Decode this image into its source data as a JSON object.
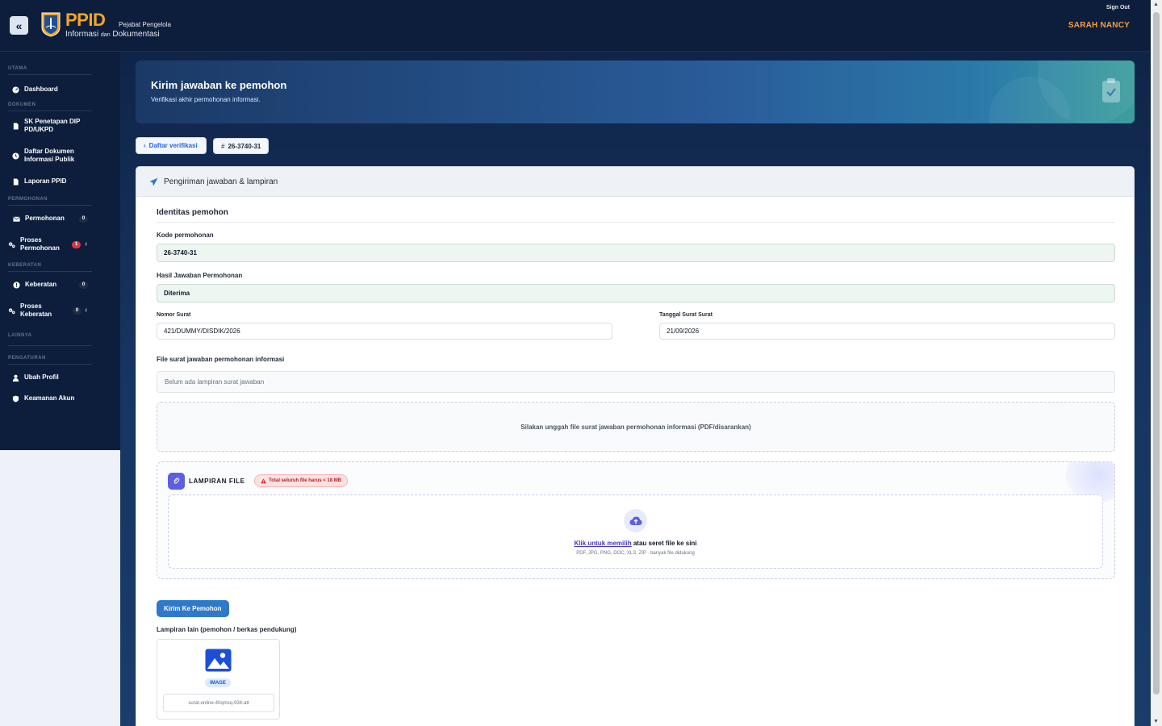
{
  "header": {
    "logo_text": "PPID",
    "logo_sub_top": "Pejabat Pengelola",
    "logo_sub_info": "Informasi",
    "logo_sub_dan": "dan",
    "logo_sub_dok": "Dokumentasi",
    "sign_out": "Sign Out",
    "user_name": "SARAH NANCY",
    "accent_color": "#f5a524"
  },
  "sidebar": {
    "sections": [
      {
        "title": "UTAMA",
        "items": [
          {
            "label": "Dashboard",
            "icon": "dashboard-icon"
          }
        ]
      },
      {
        "title": "DOKUMEN",
        "items": [
          {
            "label": "SK Penetapan DIP PD/UKPD",
            "icon": "file-icon"
          },
          {
            "label": "Daftar Dokumen Informasi Publik",
            "icon": "clock-icon"
          },
          {
            "label": "Laporan PPID",
            "icon": "file-icon"
          }
        ]
      },
      {
        "title": "PERMOHONAN",
        "items": [
          {
            "label": "Permohonan",
            "icon": "envelope-icon",
            "badge": "0"
          },
          {
            "label": "Proses Permohonan",
            "icon": "cogs-icon",
            "badge": "1"
          }
        ]
      },
      {
        "title": "KEBERATAN",
        "items": [
          {
            "label": "Keberatan",
            "icon": "alert-icon",
            "badge": "0"
          },
          {
            "label": "Proses Keberatan",
            "icon": "cogs-icon",
            "badge": "0"
          }
        ]
      },
      {
        "title": "LAINNYA",
        "items": []
      },
      {
        "title": "PENGATURAN",
        "items": [
          {
            "label": "Ubah Profil",
            "icon": "user-icon"
          },
          {
            "label": "Keamanan Akun",
            "icon": "shield-icon"
          }
        ]
      }
    ]
  },
  "hero": {
    "title": "Kirim jawaban ke pemohon",
    "subtitle": "Verifikasi akhir permohonan informasi."
  },
  "breadcrumb": {
    "back_label": "Daftar verifikasi",
    "code_label": "26-3740-31"
  },
  "card": {
    "header": "Pengiriman jawaban & lampiran",
    "section_title": "Identitas pemohon",
    "kode_label": "Kode permohonan",
    "kode_value": "26-3740-31",
    "hasil_label": "Hasil Jawaban Permohonan",
    "hasil_value": "Diterima",
    "nomor_label": "Nomor Surat",
    "nomor_value": "421/DUMMY/DISDIK/2026",
    "tanggal_label": "Tanggal Surat Surat",
    "tanggal_value": "21/09/2026",
    "file_label": "File surat jawaban permohonan informasi",
    "file_placeholder": "Belum ada lampiran surat jawaban",
    "file_drop_text": "Silakan unggah file surat jawaban permohonan informasi (PDF/disarankan)",
    "attach_title": "LAMPIRAN FILE",
    "attach_warning": "Total seluruh file harus < 18 MB",
    "drop_link": "Klik untuk memilih",
    "drop_text": "atau seret file ke sini",
    "drop_sub": "PDF, JPG, PNG, DOC, XLS, ZIP · banyak file didukung",
    "send_button": "Kirim Ke Pemohon",
    "other_label": "Lampiran lain (pemohon / berkas pendukung)",
    "other_file_tag": "IMAGE",
    "other_file_name": "surat-online-40qmsq-934-att"
  }
}
